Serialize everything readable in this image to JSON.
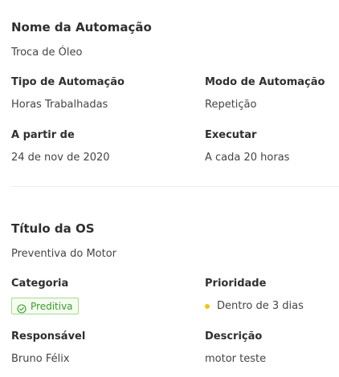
{
  "automation": {
    "name_label": "Nome da Automação",
    "name_value": "Troca de Óleo",
    "type_label": "Tipo de Automação",
    "type_value": "Horas Trabalhadas",
    "mode_label": "Modo de Automação",
    "mode_value": "Repetição",
    "start_label": "A partir de",
    "start_value": "24 de nov de 2020",
    "execute_label": "Executar",
    "execute_value": "A cada 20 horas"
  },
  "os": {
    "title_label": "Título da OS",
    "title_value": "Preventiva do Motor",
    "category_label": "Categoria",
    "category_value": "Preditiva",
    "category_icon": "check-circle-icon",
    "category_color": "#3c9b2c",
    "priority_label": "Prioridade",
    "priority_value": "Dentro de 3 dias",
    "priority_color": "#f1c40f",
    "responsible_label": "Responsável",
    "responsible_value": "Bruno Félix",
    "description_label": "Descrição",
    "description_value": "motor teste"
  }
}
